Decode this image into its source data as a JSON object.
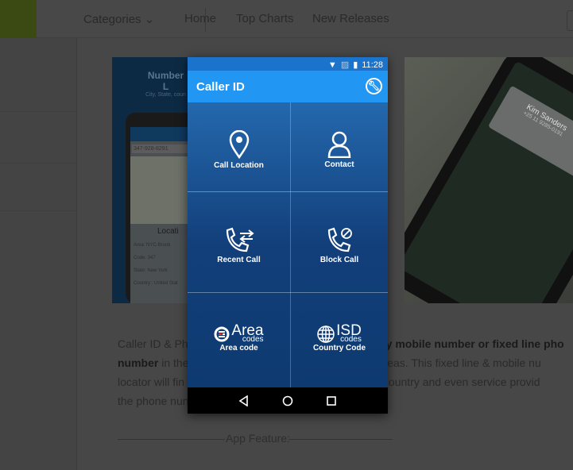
{
  "topnav": {
    "categories": "Categories",
    "home": "Home",
    "top_charts": "Top Charts",
    "new_releases": "New Releases"
  },
  "screenshot1": {
    "title": "Number L",
    "subtitle": "City, State, coun",
    "number": "347-928-8291",
    "location": "Locati",
    "rows": [
      [
        "Area:",
        "NYC-Brook"
      ],
      [
        "Code:",
        "347"
      ],
      [
        "State:",
        "New York"
      ],
      [
        "Country :",
        "United Stat"
      ]
    ]
  },
  "screenshot2": {
    "name": "Kim Sanders",
    "number": "+25 11 9285-0191"
  },
  "description": {
    "line1a": "Caller ID & Pho",
    "line1b": "te any mobile number or fixed line pho",
    "line2a": "number",
    "line2b": " in the",
    "line2c": "cities areas. This fixed line & mobile nu",
    "line3a": "locator will fin",
    "line3b": ", state, country and even service provid",
    "line4a": "the phone nun"
  },
  "feature_heading": "App Feature:",
  "app": {
    "status_time": "11:28",
    "title": "Caller ID",
    "tiles": [
      {
        "label": "Call Location",
        "icon": "location-pin-icon"
      },
      {
        "label": "Contact",
        "icon": "contact-icon"
      },
      {
        "label": "Recent Call",
        "icon": "recent-call-icon"
      },
      {
        "label": "Block Call",
        "icon": "block-call-icon"
      },
      {
        "label": "Area code",
        "icon": "area-codes-icon",
        "logo_big": "Area",
        "logo_small": "codes"
      },
      {
        "label": "Country Code",
        "icon": "isd-codes-icon",
        "logo_big": "ISD",
        "logo_small": "codes"
      }
    ]
  }
}
